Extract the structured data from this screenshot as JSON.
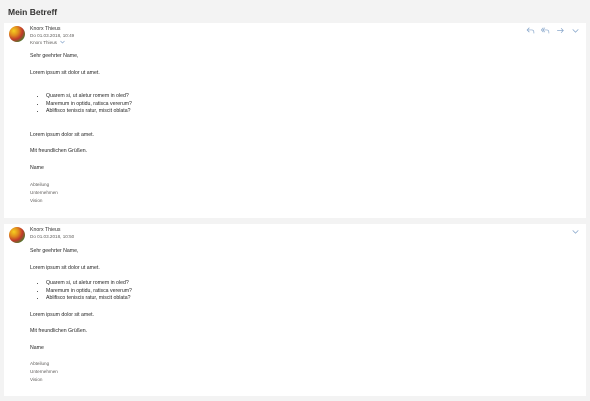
{
  "header": {
    "subject": "Mein Betreff"
  },
  "messages": [
    {
      "sender": "Knorx Thieus",
      "date": "Do 01.03.2018, 10:49",
      "to": "Knorx Thieus",
      "to_chevron": "chevron-down-icon",
      "actions": [
        "reply-icon",
        "reply-all-icon",
        "forward-icon",
        "chevron-down-icon"
      ],
      "greeting": "Sehr geehrter Name,",
      "intro": "Lorem ipsum sit dolor ut amet.",
      "list": [
        "Quarem si, ut aletur romem in oled?",
        "Maremum in optidu, ratisca vererum?",
        "Ablifisco teniscis ratur, miscit oblata?"
      ],
      "outro": "Lorem ipsum dolor sit amet.",
      "closing": "Mit freundlichen Grüßen.",
      "name": "Name",
      "signature": [
        "Abteilung",
        "Unternehmen",
        "Vision"
      ]
    },
    {
      "sender": "Knorx Thieus",
      "date": "Do 01.03.2018, 10:50",
      "actions": [
        "chevron-down-icon"
      ],
      "greeting": "Sehr geehrter Name,",
      "intro": "Lorem ipsum sit dolor ut amet.",
      "list": [
        "Quarem si, ut aletur romem in oled?",
        "Maremum in optidu, ratisca vererum?",
        "Ablifisco teniscis ratur, miscit oblata?"
      ],
      "outro": "Lorem ipsum dolor sit amet.",
      "closing": "Mit freundlichen Grüßen.",
      "name": "Name",
      "signature": [
        "Abteilung",
        "Unternehmen",
        "Vision"
      ]
    }
  ],
  "colors": {
    "accent": "#8aa8cc",
    "background": "#f3f3f3",
    "card": "#ffffff"
  }
}
